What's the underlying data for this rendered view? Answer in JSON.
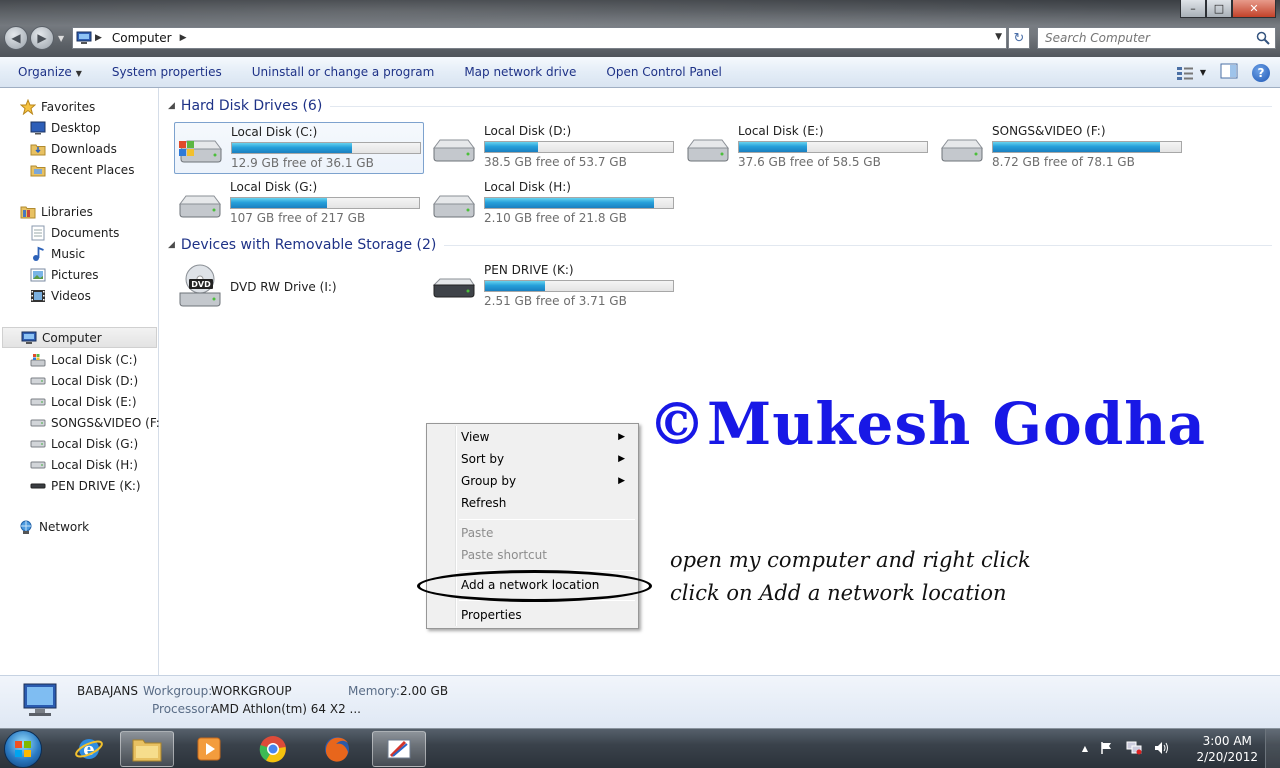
{
  "window": {
    "minimize_symbol": "–",
    "maximize_symbol": "□",
    "close_symbol": "✕"
  },
  "address": {
    "path": "Computer",
    "separator": "▶",
    "dropdown": "▼",
    "refresh": "↻"
  },
  "search": {
    "placeholder": "Search Computer"
  },
  "commandbar": {
    "organize": "Organize",
    "caret": "▼",
    "items": [
      "System properties",
      "Uninstall or change a program",
      "Map network drive",
      "Open Control Panel"
    ],
    "help": "?"
  },
  "nav": {
    "favorites": "Favorites",
    "desktop": "Desktop",
    "downloads": "Downloads",
    "recent_places": "Recent Places",
    "libraries": "Libraries",
    "documents": "Documents",
    "music": "Music",
    "pictures": "Pictures",
    "videos": "Videos",
    "computer": "Computer",
    "drives": [
      "Local Disk (C:)",
      "Local Disk (D:)",
      "Local Disk (E:)",
      "SONGS&VIDEO (F:)",
      "Local Disk (G:)",
      "Local Disk (H:)",
      "PEN DRIVE (K:)"
    ],
    "network": "Network"
  },
  "groups": {
    "hard_disks": "Hard Disk Drives (6)",
    "removable": "Devices with Removable Storage (2)",
    "collapse": "◢"
  },
  "drives": [
    {
      "name": "Local Disk (C:)",
      "free": "12.9 GB free of 36.1 GB",
      "used_fraction": 0.64
    },
    {
      "name": "Local Disk (D:)",
      "free": "38.5 GB free of 53.7 GB",
      "used_fraction": 0.28
    },
    {
      "name": "Local Disk (E:)",
      "free": "37.6 GB free of 58.5 GB",
      "used_fraction": 0.36
    },
    {
      "name": "SONGS&VIDEO (F:)",
      "free": "8.72 GB free of 78.1 GB",
      "used_fraction": 0.89
    },
    {
      "name": "Local Disk (G:)",
      "free": "107 GB free of 217 GB",
      "used_fraction": 0.51
    },
    {
      "name": "Local Disk (H:)",
      "free": "2.10 GB free of 21.8 GB",
      "used_fraction": 0.9
    }
  ],
  "removable": [
    {
      "name": "DVD RW Drive (I:)"
    },
    {
      "name": "PEN DRIVE (K:)",
      "free": "2.51 GB free of 3.71 GB",
      "used_fraction": 0.32
    }
  ],
  "context_menu": {
    "view": "View",
    "sort_by": "Sort by",
    "group_by": "Group by",
    "refresh": "Refresh",
    "paste": "Paste",
    "paste_shortcut": "Paste shortcut",
    "add_network_location": "Add a network location",
    "properties": "Properties",
    "submenu_arrow": "▶"
  },
  "watermark": "©Mukesh Godha",
  "notes": [
    "open my computer and right click",
    "click on Add a network location"
  ],
  "details": {
    "computer_name": "BABAJANS",
    "workgroup_label": "Workgroup:",
    "workgroup_value": "WORKGROUP",
    "memory_label": "Memory:",
    "memory_value": "2.00 GB",
    "processor_label": "Processor:",
    "processor_value": "AMD Athlon(tm) 64 X2 ..."
  },
  "taskbar": {
    "tray_up": "▲",
    "time": "3:00 AM",
    "date": "2/20/2012"
  },
  "colors": {
    "accent_link": "#1e3287",
    "bar_fill": "#26a0da",
    "watermark": "#1818e6"
  }
}
